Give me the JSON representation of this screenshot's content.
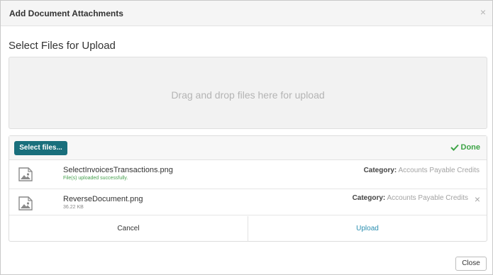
{
  "dialog": {
    "title": "Add Document Attachments",
    "close_symbol": "×"
  },
  "upload": {
    "section_title": "Select Files for Upload",
    "dropzone_text": "Drag and drop files here for upload",
    "select_files_label": "Select files...",
    "status_label": "Done",
    "files": [
      {
        "name": "SelectInvoicesTransactions.png",
        "status": "File(s) uploaded successfully.",
        "category_label": "Category:",
        "category_value": "Accounts Payable Credits",
        "icon": "image-file-icon"
      },
      {
        "name": "ReverseDocument.png",
        "size": "36.22 KB",
        "category_label": "Category:",
        "category_value": "Accounts Payable Credits",
        "remove_symbol": "×",
        "icon": "image-file-icon"
      }
    ],
    "cancel_label": "Cancel",
    "upload_label": "Upload"
  },
  "footer": {
    "close_label": "Close"
  },
  "colors": {
    "primary_button": "#196f7c",
    "success": "#3ea447",
    "link": "#2a8eb0"
  }
}
